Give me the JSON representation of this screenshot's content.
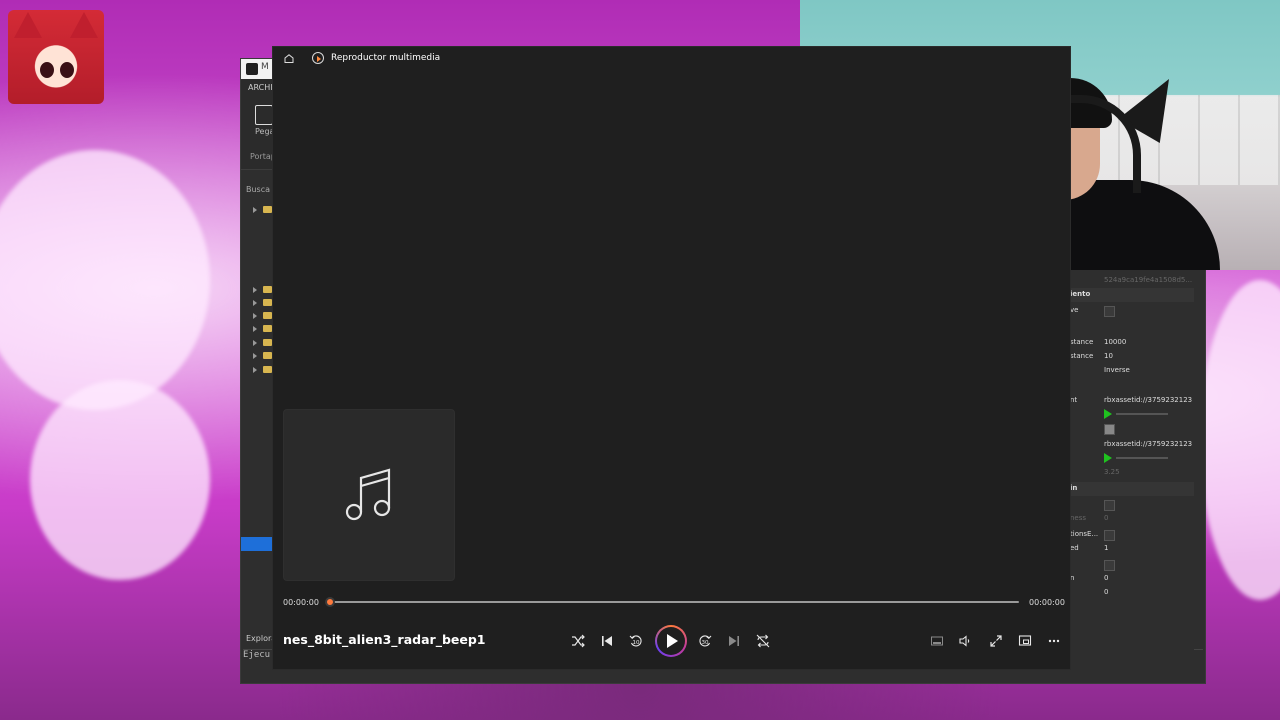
{
  "media_player": {
    "app_title": "Reproductor multimedia",
    "track_title": "nes_8bit_alien3_radar_beep1",
    "elapsed": "00:00:00",
    "duration": "00:00:00",
    "progress": 0,
    "accent_color": "#ff7a3d",
    "icons": {
      "home": "home-icon",
      "shuffle": "shuffle-icon",
      "previous": "previous-icon",
      "rewind": "rewind-10-icon",
      "play": "play-icon",
      "forward": "forward-30-icon",
      "next": "next-icon",
      "repeat": "repeat-off-icon",
      "miniplayer": "miniplayer-icon",
      "volume": "volume-icon",
      "fullscreen": "fullscreen-icon",
      "cast": "cast-icon",
      "more": "more-icon"
    },
    "rewind_label": "10",
    "forward_label": "30"
  },
  "studio": {
    "window_title": "M",
    "menu_label": "ARCHI",
    "paste_label": "Pega",
    "clipboard_group": "Portap",
    "search_label": "Busca",
    "explorer_label": "Explora",
    "command_label": "Ejecu"
  },
  "properties": {
    "rows": [
      {
        "key": "",
        "value": "524a9ca19fe4a1508d5...",
        "kind": "dim"
      },
      {
        "key": "iento",
        "value": "",
        "kind": "header"
      },
      {
        "key": "ve",
        "value": "",
        "kind": "check"
      },
      {
        "key": "",
        "value": "",
        "kind": "blank"
      },
      {
        "key": "stance",
        "value": "10000",
        "kind": "text"
      },
      {
        "key": "stance",
        "value": "10",
        "kind": "text"
      },
      {
        "key": "",
        "value": "Inverse",
        "kind": "text"
      },
      {
        "key": "",
        "value": "",
        "kind": "blank"
      },
      {
        "key": "nt",
        "value": "rbxassetid://3759232123",
        "kind": "text"
      },
      {
        "key": "",
        "value": "",
        "kind": "play"
      },
      {
        "key": "",
        "value": "",
        "kind": "check-on"
      },
      {
        "key": "",
        "value": "rbxassetid://3759232123",
        "kind": "text"
      },
      {
        "key": "",
        "value": "",
        "kind": "play"
      },
      {
        "key": "",
        "value": "3.25",
        "kind": "dim"
      },
      {
        "key": "in",
        "value": "",
        "kind": "header"
      },
      {
        "key": "",
        "value": "",
        "kind": "check"
      },
      {
        "key": "ness",
        "value": "0",
        "kind": "dim"
      },
      {
        "key": "tionsE...",
        "value": "",
        "kind": "check"
      },
      {
        "key": "ed",
        "value": "1",
        "kind": "text"
      },
      {
        "key": "",
        "value": "",
        "kind": "check"
      },
      {
        "key": "n",
        "value": "0",
        "kind": "text"
      },
      {
        "key": "",
        "value": "0",
        "kind": "text"
      }
    ]
  }
}
